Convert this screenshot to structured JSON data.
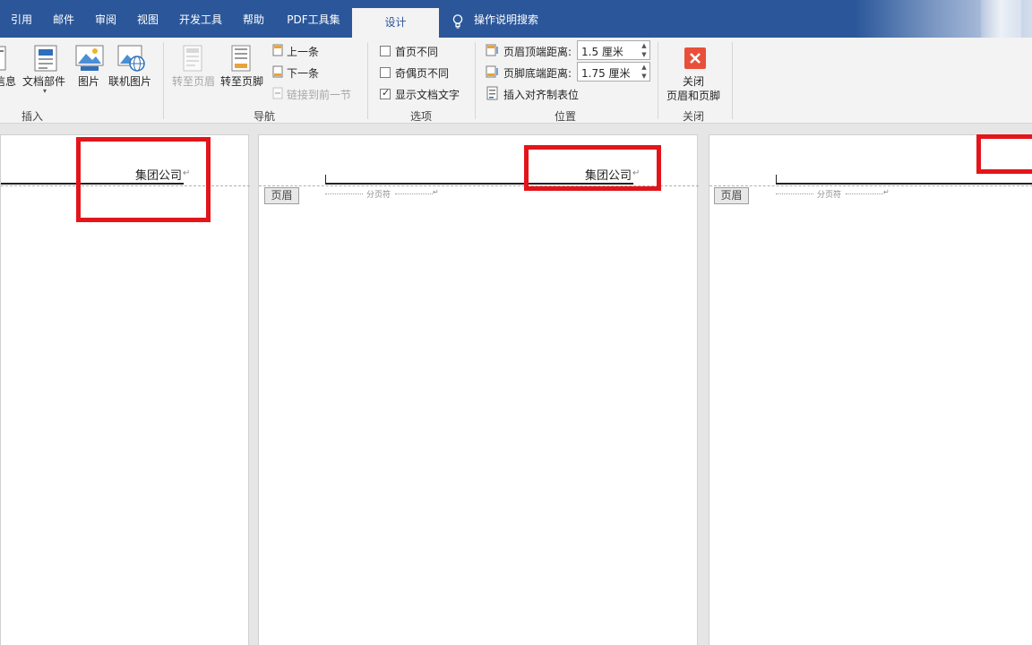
{
  "tabs": [
    {
      "label": "引用"
    },
    {
      "label": "邮件"
    },
    {
      "label": "审阅"
    },
    {
      "label": "视图"
    },
    {
      "label": "开发工具"
    },
    {
      "label": "帮助"
    },
    {
      "label": "PDF工具集"
    },
    {
      "label": "设计"
    }
  ],
  "tell_me": "操作说明搜索",
  "insert_group": {
    "doc_info_label": "信息",
    "doc_parts_label": "文档部件",
    "pictures_label": "图片",
    "online_pictures_label": "联机图片",
    "group_label": "插入"
  },
  "nav_group": {
    "goto_header": "转至页眉",
    "goto_footer": "转至页脚",
    "previous": "上一条",
    "next": "下一条",
    "link_previous": "链接到前一节",
    "group_label": "导航"
  },
  "options_group": {
    "different_first": "首页不同",
    "different_odd_even": "奇偶页不同",
    "show_doc_text": "显示文档文字",
    "group_label": "选项"
  },
  "position_group": {
    "header_from_top_label": "页眉顶端距离:",
    "header_from_top_value": "1.5 厘米",
    "footer_from_bottom_label": "页脚底端距离:",
    "footer_from_bottom_value": "1.75 厘米",
    "insert_align_tab": "插入对齐制表位",
    "group_label": "位置"
  },
  "close_group": {
    "close_line1": "关闭",
    "close_line2": "页眉和页脚",
    "group_label": "关闭"
  },
  "pages": [
    {
      "header_text": "集团公司"
    },
    {
      "header_text": "集团公司",
      "header_tag": "页眉",
      "page_break": "分页符"
    },
    {
      "header_tag": "页眉",
      "page_break": "分页符"
    }
  ],
  "colors": {
    "tab_bar": "#2b579a",
    "ribbon": "#f3f3f3",
    "highlight_box": "#e3151a",
    "close_icon": "#e8503a"
  }
}
